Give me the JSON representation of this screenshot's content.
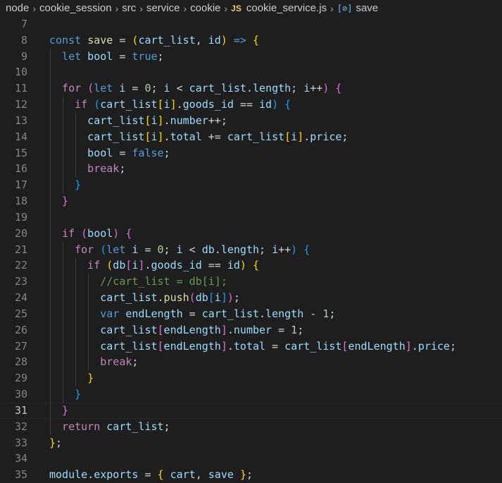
{
  "breadcrumb": {
    "items": [
      "node",
      "cookie_session",
      "src",
      "service",
      "cookie"
    ],
    "file_badge": "JS",
    "file_name": "cookie_service.js",
    "symbol_icon": "[⊘]",
    "symbol_name": "save"
  },
  "icons": {
    "file_type": "javascript-icon",
    "symbol": "function-symbol-icon",
    "separator": "chevron-right-icon"
  },
  "colors": {
    "background": "#1e1e1e",
    "keyword": "#569cd6",
    "control": "#c586c0",
    "variable": "#9cdcfe",
    "function": "#dcdcaa",
    "number": "#b5cea8",
    "comment": "#6a9955",
    "bracket_1": "#ffd700",
    "bracket_2": "#da70d6",
    "bracket_3": "#179fff"
  },
  "editor": {
    "current_line": "31",
    "lines": [
      {
        "num": "7",
        "indent": 0,
        "tokens": []
      },
      {
        "num": "8",
        "indent": 0,
        "tokens": [
          [
            "k",
            "const"
          ],
          [
            "o",
            " "
          ],
          [
            "f",
            "save"
          ],
          [
            "o",
            " = "
          ],
          [
            "b1",
            "("
          ],
          [
            "v",
            "cart_list"
          ],
          [
            "o",
            ", "
          ],
          [
            "v",
            "id"
          ],
          [
            "b1",
            ")"
          ],
          [
            "o",
            " "
          ],
          [
            "k",
            "=>"
          ],
          [
            "o",
            " "
          ],
          [
            "b1",
            "{"
          ]
        ]
      },
      {
        "num": "9",
        "indent": 1,
        "tokens": [
          [
            "k",
            "let"
          ],
          [
            "o",
            " "
          ],
          [
            "v",
            "bool"
          ],
          [
            "o",
            " = "
          ],
          [
            "k",
            "true"
          ],
          [
            "o",
            ";"
          ]
        ]
      },
      {
        "num": "10",
        "indent": 1,
        "tokens": []
      },
      {
        "num": "11",
        "indent": 1,
        "tokens": [
          [
            "c",
            "for"
          ],
          [
            "o",
            " "
          ],
          [
            "b2",
            "("
          ],
          [
            "k",
            "let"
          ],
          [
            "o",
            " "
          ],
          [
            "v",
            "i"
          ],
          [
            "o",
            " = "
          ],
          [
            "n",
            "0"
          ],
          [
            "o",
            "; "
          ],
          [
            "v",
            "i"
          ],
          [
            "o",
            " < "
          ],
          [
            "v",
            "cart_list"
          ],
          [
            "o",
            "."
          ],
          [
            "v",
            "length"
          ],
          [
            "o",
            "; "
          ],
          [
            "v",
            "i"
          ],
          [
            "o",
            "++"
          ],
          [
            "b2",
            ")"
          ],
          [
            "o",
            " "
          ],
          [
            "b2",
            "{"
          ]
        ]
      },
      {
        "num": "12",
        "indent": 2,
        "tokens": [
          [
            "c",
            "if"
          ],
          [
            "o",
            " "
          ],
          [
            "b3",
            "("
          ],
          [
            "v",
            "cart_list"
          ],
          [
            "b1",
            "["
          ],
          [
            "v",
            "i"
          ],
          [
            "b1",
            "]"
          ],
          [
            "o",
            "."
          ],
          [
            "v",
            "goods_id"
          ],
          [
            "o",
            " == "
          ],
          [
            "v",
            "id"
          ],
          [
            "b3",
            ")"
          ],
          [
            "o",
            " "
          ],
          [
            "b3",
            "{"
          ]
        ]
      },
      {
        "num": "13",
        "indent": 3,
        "tokens": [
          [
            "v",
            "cart_list"
          ],
          [
            "b1",
            "["
          ],
          [
            "v",
            "i"
          ],
          [
            "b1",
            "]"
          ],
          [
            "o",
            "."
          ],
          [
            "v",
            "number"
          ],
          [
            "o",
            "++;"
          ]
        ]
      },
      {
        "num": "14",
        "indent": 3,
        "tokens": [
          [
            "v",
            "cart_list"
          ],
          [
            "b1",
            "["
          ],
          [
            "v",
            "i"
          ],
          [
            "b1",
            "]"
          ],
          [
            "o",
            "."
          ],
          [
            "v",
            "total"
          ],
          [
            "o",
            " += "
          ],
          [
            "v",
            "cart_list"
          ],
          [
            "b1",
            "["
          ],
          [
            "v",
            "i"
          ],
          [
            "b1",
            "]"
          ],
          [
            "o",
            "."
          ],
          [
            "v",
            "price"
          ],
          [
            "o",
            ";"
          ]
        ]
      },
      {
        "num": "15",
        "indent": 3,
        "tokens": [
          [
            "v",
            "bool"
          ],
          [
            "o",
            " = "
          ],
          [
            "k",
            "false"
          ],
          [
            "o",
            ";"
          ]
        ]
      },
      {
        "num": "16",
        "indent": 3,
        "tokens": [
          [
            "c",
            "break"
          ],
          [
            "o",
            ";"
          ]
        ]
      },
      {
        "num": "17",
        "indent": 2,
        "tokens": [
          [
            "b3",
            "}"
          ]
        ]
      },
      {
        "num": "18",
        "indent": 1,
        "tokens": [
          [
            "b2",
            "}"
          ]
        ]
      },
      {
        "num": "19",
        "indent": 1,
        "tokens": []
      },
      {
        "num": "20",
        "indent": 1,
        "tokens": [
          [
            "c",
            "if"
          ],
          [
            "o",
            " "
          ],
          [
            "b2",
            "("
          ],
          [
            "v",
            "bool"
          ],
          [
            "b2",
            ")"
          ],
          [
            "o",
            " "
          ],
          [
            "b2",
            "{"
          ]
        ]
      },
      {
        "num": "21",
        "indent": 2,
        "tokens": [
          [
            "c",
            "for"
          ],
          [
            "o",
            " "
          ],
          [
            "b3",
            "("
          ],
          [
            "k",
            "let"
          ],
          [
            "o",
            " "
          ],
          [
            "v",
            "i"
          ],
          [
            "o",
            " = "
          ],
          [
            "n",
            "0"
          ],
          [
            "o",
            "; "
          ],
          [
            "v",
            "i"
          ],
          [
            "o",
            " < "
          ],
          [
            "v",
            "db"
          ],
          [
            "o",
            "."
          ],
          [
            "v",
            "length"
          ],
          [
            "o",
            "; "
          ],
          [
            "v",
            "i"
          ],
          [
            "o",
            "++"
          ],
          [
            "b3",
            ")"
          ],
          [
            "o",
            " "
          ],
          [
            "b3",
            "{"
          ]
        ]
      },
      {
        "num": "22",
        "indent": 3,
        "tokens": [
          [
            "c",
            "if"
          ],
          [
            "o",
            " "
          ],
          [
            "b1",
            "("
          ],
          [
            "v",
            "db"
          ],
          [
            "b2",
            "["
          ],
          [
            "v",
            "i"
          ],
          [
            "b2",
            "]"
          ],
          [
            "o",
            "."
          ],
          [
            "v",
            "goods_id"
          ],
          [
            "o",
            " == "
          ],
          [
            "v",
            "id"
          ],
          [
            "b1",
            ")"
          ],
          [
            "o",
            " "
          ],
          [
            "b1",
            "{"
          ]
        ]
      },
      {
        "num": "23",
        "indent": 4,
        "tokens": [
          [
            "cm",
            "//cart_list = db[i];"
          ]
        ]
      },
      {
        "num": "24",
        "indent": 4,
        "tokens": [
          [
            "v",
            "cart_list"
          ],
          [
            "o",
            "."
          ],
          [
            "f",
            "push"
          ],
          [
            "b2",
            "("
          ],
          [
            "v",
            "db"
          ],
          [
            "b3",
            "["
          ],
          [
            "v",
            "i"
          ],
          [
            "b3",
            "]"
          ],
          [
            "b2",
            ")"
          ],
          [
            "o",
            ";"
          ]
        ]
      },
      {
        "num": "25",
        "indent": 4,
        "tokens": [
          [
            "k",
            "var"
          ],
          [
            "o",
            " "
          ],
          [
            "v",
            "endLength"
          ],
          [
            "o",
            " = "
          ],
          [
            "v",
            "cart_list"
          ],
          [
            "o",
            "."
          ],
          [
            "v",
            "length"
          ],
          [
            "o",
            " - "
          ],
          [
            "n",
            "1"
          ],
          [
            "o",
            ";"
          ]
        ]
      },
      {
        "num": "26",
        "indent": 4,
        "tokens": [
          [
            "v",
            "cart_list"
          ],
          [
            "b2",
            "["
          ],
          [
            "v",
            "endLength"
          ],
          [
            "b2",
            "]"
          ],
          [
            "o",
            "."
          ],
          [
            "v",
            "number"
          ],
          [
            "o",
            " = "
          ],
          [
            "n",
            "1"
          ],
          [
            "o",
            ";"
          ]
        ]
      },
      {
        "num": "27",
        "indent": 4,
        "tokens": [
          [
            "v",
            "cart_list"
          ],
          [
            "b2",
            "["
          ],
          [
            "v",
            "endLength"
          ],
          [
            "b2",
            "]"
          ],
          [
            "o",
            "."
          ],
          [
            "v",
            "total"
          ],
          [
            "o",
            " = "
          ],
          [
            "v",
            "cart_list"
          ],
          [
            "b2",
            "["
          ],
          [
            "v",
            "endLength"
          ],
          [
            "b2",
            "]"
          ],
          [
            "o",
            "."
          ],
          [
            "v",
            "price"
          ],
          [
            "o",
            ";"
          ]
        ]
      },
      {
        "num": "28",
        "indent": 4,
        "tokens": [
          [
            "c",
            "break"
          ],
          [
            "o",
            ";"
          ]
        ]
      },
      {
        "num": "29",
        "indent": 3,
        "tokens": [
          [
            "b1",
            "}"
          ]
        ]
      },
      {
        "num": "30",
        "indent": 2,
        "tokens": [
          [
            "b3",
            "}"
          ]
        ]
      },
      {
        "num": "31",
        "indent": 1,
        "tokens": [
          [
            "b2",
            "}"
          ]
        ]
      },
      {
        "num": "32",
        "indent": 1,
        "tokens": [
          [
            "c",
            "return"
          ],
          [
            "o",
            " "
          ],
          [
            "v",
            "cart_list"
          ],
          [
            "o",
            ";"
          ]
        ]
      },
      {
        "num": "33",
        "indent": 0,
        "tokens": [
          [
            "b1",
            "}"
          ],
          [
            "o",
            ";"
          ]
        ]
      },
      {
        "num": "34",
        "indent": 0,
        "tokens": []
      },
      {
        "num": "35",
        "indent": 0,
        "tokens": [
          [
            "v",
            "module"
          ],
          [
            "o",
            "."
          ],
          [
            "v",
            "exports"
          ],
          [
            "o",
            " = "
          ],
          [
            "b1",
            "{"
          ],
          [
            "o",
            " "
          ],
          [
            "v",
            "cart"
          ],
          [
            "o",
            ", "
          ],
          [
            "v",
            "save"
          ],
          [
            "o",
            " "
          ],
          [
            "b1",
            "}"
          ],
          [
            "o",
            ";"
          ]
        ]
      }
    ]
  }
}
